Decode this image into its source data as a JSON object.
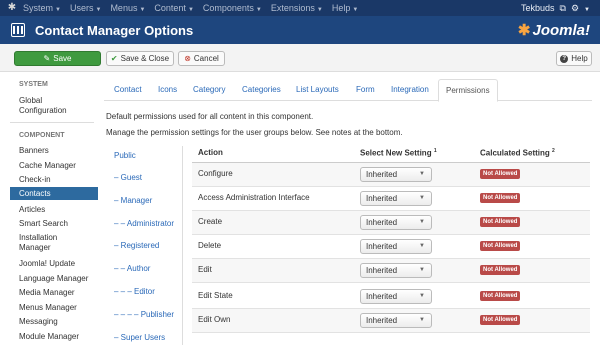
{
  "topbar": {
    "menus": [
      "System",
      "Users",
      "Menus",
      "Content",
      "Components",
      "Extensions",
      "Help"
    ],
    "user": "Tekbuds",
    "external_icon": "external-link-icon",
    "settings_icon": "gear-icon"
  },
  "header": {
    "title": "Contact Manager Options",
    "brand": "Joomla!"
  },
  "toolbar": {
    "save_label": "Save",
    "save_close_label": "Save & Close",
    "cancel_label": "Cancel",
    "help_label": "Help"
  },
  "sidebar": {
    "system_heading": "SYSTEM",
    "global_config": [
      "Global",
      "Configuration"
    ],
    "component_heading": "COMPONENT",
    "items": [
      "Banners",
      "Cache Manager",
      "Check-in",
      "Contacts",
      "Articles",
      "Smart Search",
      "Installation",
      "Manager",
      "Joomla! Update",
      "Language Manager",
      "Media Manager",
      "Menus Manager",
      "Messaging",
      "Module Manager"
    ],
    "active": "Contacts"
  },
  "tabs": [
    "Contact",
    "Icons",
    "Category",
    "Categories",
    "List Layouts",
    "Form",
    "Integration",
    "Permissions"
  ],
  "active_tab": "Permissions",
  "description": [
    "Default permissions used for all content in this component.",
    "Manage the permission settings for the user groups below. See notes at the bottom."
  ],
  "groups": [
    "Public",
    "– Guest",
    "– Manager",
    "– – Administrator",
    "– Registered",
    "– – Author",
    "– – – Editor",
    "– – – – Publisher",
    "– Super Users"
  ],
  "table": {
    "headers": {
      "action": "Action",
      "select": "Select New Setting",
      "select_note": "1",
      "calculated": "Calculated Setting",
      "calculated_note": "2"
    },
    "rows": [
      {
        "action": "Configure",
        "setting": "Inherited",
        "calculated": "Not Allowed"
      },
      {
        "action": "Access Administration Interface",
        "setting": "Inherited",
        "calculated": "Not Allowed"
      },
      {
        "action": "Create",
        "setting": "Inherited",
        "calculated": "Not Allowed"
      },
      {
        "action": "Delete",
        "setting": "Inherited",
        "calculated": "Not Allowed"
      },
      {
        "action": "Edit",
        "setting": "Inherited",
        "calculated": "Not Allowed"
      },
      {
        "action": "Edit State",
        "setting": "Inherited",
        "calculated": "Not Allowed"
      },
      {
        "action": "Edit Own",
        "setting": "Inherited",
        "calculated": "Not Allowed"
      }
    ]
  },
  "colors": {
    "topbar": "#1a3867",
    "header": "#1e467e",
    "save_button": "#3f9a3f",
    "active_sidebar": "#2d6a9f",
    "badge_danger": "#b94a48",
    "link": "#2a69b8"
  }
}
